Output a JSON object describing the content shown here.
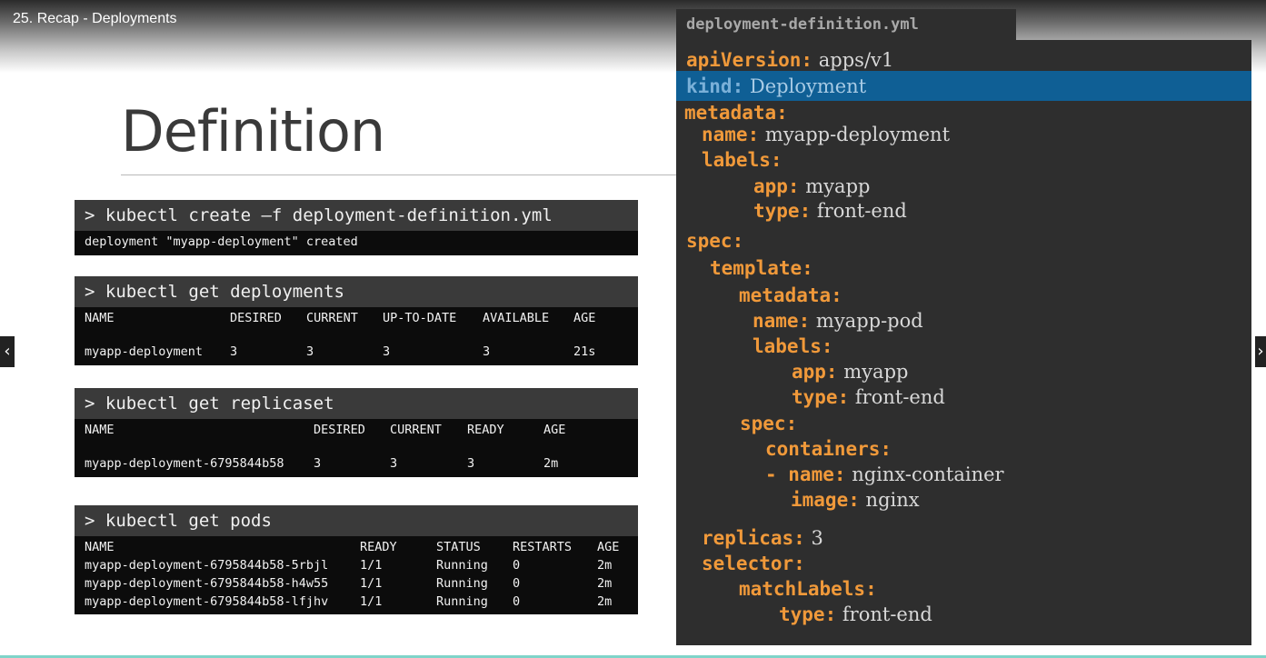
{
  "lesson_title": "25. Recap - Deployments",
  "slide_heading": "Definition",
  "nav": {
    "prev_icon": "‹",
    "next_icon": "›"
  },
  "terminals": {
    "create": {
      "command": "> kubectl create –f deployment-definition.yml",
      "output": "deployment \"myapp-deployment\" created"
    },
    "deployments": {
      "command": "> kubectl get deployments",
      "headers": [
        "NAME",
        "DESIRED",
        "CURRENT",
        "UP-TO-DATE",
        "AVAILABLE",
        "AGE"
      ],
      "rows": [
        [
          "myapp-deployment",
          "3",
          "3",
          "3",
          "3",
          "21s"
        ]
      ]
    },
    "replicaset": {
      "command": "> kubectl get replicaset",
      "headers": [
        "NAME",
        "DESIRED",
        "CURRENT",
        "READY",
        "AGE"
      ],
      "rows": [
        [
          "myapp-deployment-6795844b58",
          "3",
          "3",
          "3",
          "2m"
        ]
      ]
    },
    "pods": {
      "command": "> kubectl get pods",
      "headers": [
        "NAME",
        "READY",
        "STATUS",
        "RESTARTS",
        "AGE"
      ],
      "rows": [
        [
          "myapp-deployment-6795844b58-5rbjl",
          "1/1",
          "Running",
          "0",
          "2m"
        ],
        [
          "myapp-deployment-6795844b58-h4w55",
          "1/1",
          "Running",
          "0",
          "2m"
        ],
        [
          "myapp-deployment-6795844b58-lfjhv",
          "1/1",
          "Running",
          "0",
          "2m"
        ]
      ]
    }
  },
  "yaml": {
    "filename": "deployment-definition.yml",
    "lines": [
      {
        "key": "apiVersion:",
        "val": "apps/v1"
      },
      {
        "key": "kind:",
        "val": "Deployment"
      },
      {
        "key": "metadata:",
        "val": ""
      },
      {
        "key": "name:",
        "val": "myapp-deployment"
      },
      {
        "key": "labels:",
        "val": ""
      },
      {
        "key": "app:",
        "val": "myapp"
      },
      {
        "key": "type:",
        "val": "front-end"
      },
      {
        "key": "spec:",
        "val": ""
      },
      {
        "key": "template:",
        "val": ""
      },
      {
        "key": "metadata:",
        "val": ""
      },
      {
        "key": "name:",
        "val": "myapp-pod"
      },
      {
        "key": "labels:",
        "val": ""
      },
      {
        "key": "app:",
        "val": "myapp"
      },
      {
        "key": "type:",
        "val": "front-end"
      },
      {
        "key": "spec:",
        "val": ""
      },
      {
        "key": "containers:",
        "val": ""
      },
      {
        "key": "- name:",
        "val": "nginx-container"
      },
      {
        "key": "image:",
        "val": "nginx"
      },
      {
        "key": "replicas:",
        "val": "3"
      },
      {
        "key": "selector:",
        "val": ""
      },
      {
        "key": "matchLabels:",
        "val": ""
      },
      {
        "key": "type:",
        "val": "front-end"
      }
    ],
    "highlight_color": "#0f5f95",
    "key_color": "#f0993a"
  }
}
